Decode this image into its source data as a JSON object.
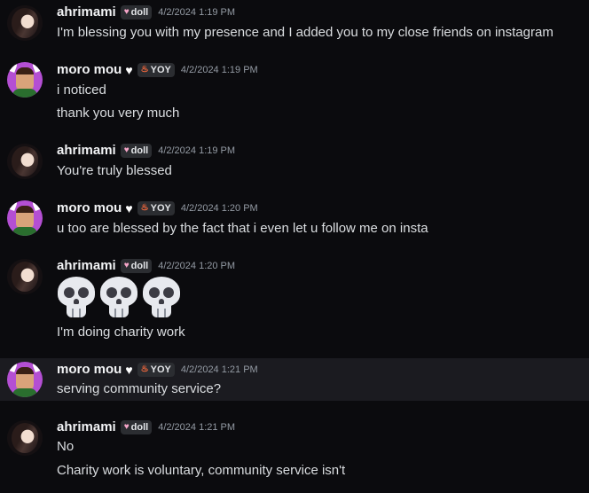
{
  "messages": [
    {
      "user": "ahrimami",
      "tag": "doll",
      "timestamp": "4/2/2024 1:19 PM",
      "lines": [
        "I'm blessing you with my presence and I added you to my close friends on instagram"
      ]
    },
    {
      "user": "moro mou",
      "tag": "YOY",
      "timestamp": "4/2/2024 1:19 PM",
      "lines": [
        "i noticed",
        "thank you very much"
      ]
    },
    {
      "user": "ahrimami",
      "tag": "doll",
      "timestamp": "4/2/2024 1:19 PM",
      "lines": [
        "You're truly blessed"
      ]
    },
    {
      "user": "moro mou",
      "tag": "YOY",
      "timestamp": "4/2/2024 1:20 PM",
      "lines": [
        "u too are blessed by the fact that i even let u follow me on insta"
      ]
    },
    {
      "user": "ahrimami",
      "tag": "doll",
      "timestamp": "4/2/2024 1:20 PM",
      "emoji": [
        "skull-emoji",
        "skull-emoji",
        "skull-emoji"
      ],
      "lines": [
        "I'm doing charity work"
      ]
    },
    {
      "user": "moro mou",
      "tag": "YOY",
      "timestamp": "4/2/2024 1:21 PM",
      "lines": [
        "serving community service?"
      ]
    },
    {
      "user": "ahrimami",
      "tag": "doll",
      "timestamp": "4/2/2024 1:21 PM",
      "lines": [
        "No",
        "Charity work is voluntary, community service isn't"
      ]
    }
  ],
  "icons": {
    "heart": "white-heart-icon",
    "doll_tag": "pink-heart-icon",
    "yoy_tag": "fire-icon"
  },
  "colors": {
    "background": "#0b0b0e",
    "highlight_row": "#1b1b20",
    "username": "#f2f3f5",
    "timestamp": "#949ba4",
    "text": "#dbdee1"
  }
}
